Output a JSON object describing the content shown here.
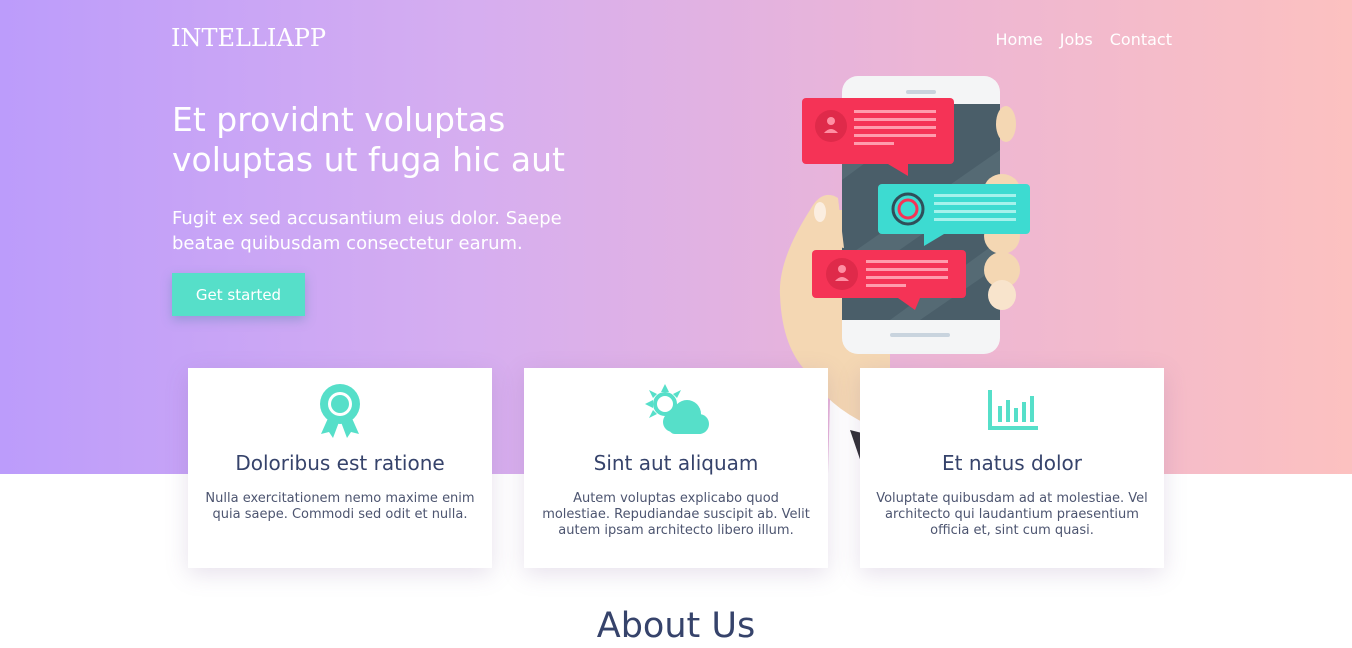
{
  "brand": {
    "logo": "INTELLIAPP"
  },
  "nav": {
    "items": [
      {
        "label": "Home"
      },
      {
        "label": "Jobs"
      },
      {
        "label": "Contact"
      }
    ]
  },
  "hero": {
    "title": "Et providnt voluptas voluptas ut fuga hic aut",
    "subtitle": "Fugit ex sed accusantium eius dolor. Saepe beatae quibusdam consectetur earum.",
    "cta_label": "Get started"
  },
  "features": [
    {
      "icon": "ribbon-award-icon",
      "title": "Doloribus est ratione",
      "text": "Nulla exercitationem nemo maxime enim quia saepe. Commodi sed odit et nulla."
    },
    {
      "icon": "sun-cloud-icon",
      "title": "Sint aut aliquam",
      "text": "Autem voluptas explicabo quod molestiae. Repudiandae suscipit ab. Velit autem ipsam architecto libero illum."
    },
    {
      "icon": "bar-chart-icon",
      "title": "Et natus dolor",
      "text": "Voluptate quibusdam ad at molestiae. Vel architecto qui laudantium praesentium officia et, sint cum quasi."
    }
  ],
  "about": {
    "heading": "About Us"
  },
  "colors": {
    "accent": "#56dfc9",
    "heading": "#36436b",
    "bubble_red": "#f53356",
    "bubble_teal": "#3ddbd1"
  }
}
